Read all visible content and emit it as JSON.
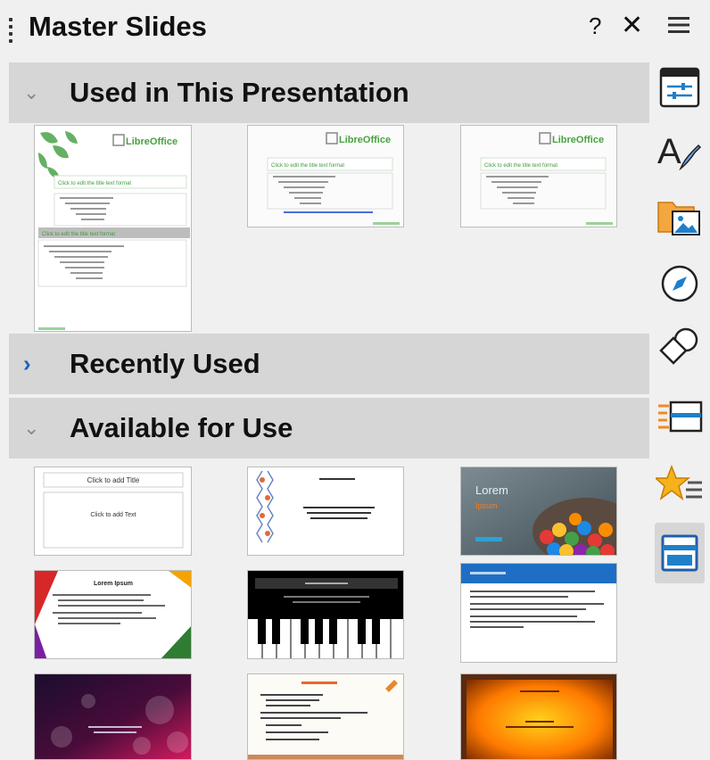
{
  "panel": {
    "title": "Master Slides",
    "help_label": "?",
    "close_label": "✕"
  },
  "sections": {
    "used": {
      "label": "Used in This Presentation",
      "expanded": true
    },
    "recent": {
      "label": "Recently Used",
      "expanded": false
    },
    "available": {
      "label": "Available for Use",
      "expanded": true
    }
  },
  "used_thumbs": {
    "brand": "LibreOffice",
    "title_prompt": "Click to edit the title text format"
  },
  "available_thumbs": {
    "plain_title": "Click to add Title",
    "plain_text": "Click to add Text",
    "photo_title": "Lorem",
    "photo_subtitle": "Ipsum",
    "geo_title": "Lorem Ipsum"
  },
  "sidebar": {
    "menu_icon": "hamburger-menu-icon",
    "buttons": [
      "properties-icon",
      "styles-icon",
      "gallery-icon",
      "navigator-icon",
      "shapes-icon",
      "slide-transition-icon",
      "animation-icon",
      "master-slides-icon"
    ],
    "active": "master-slides-icon"
  },
  "colors": {
    "section_bg": "#d6d6d6",
    "accent_blue": "#1f5fc4",
    "libre_green": "#48a23f"
  }
}
